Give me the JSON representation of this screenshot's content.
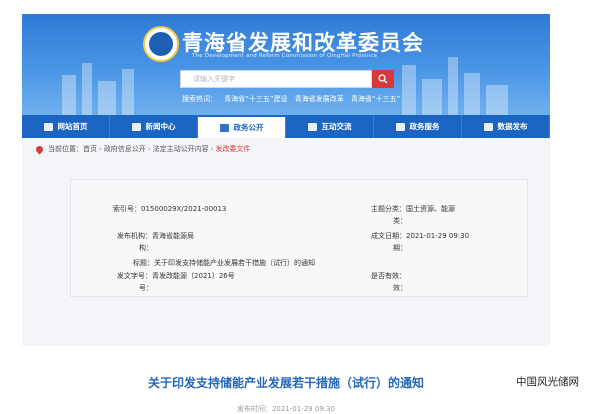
{
  "header": {
    "title": "青海省发展和改革委员会",
    "subtitle": "The Development and Reform Commission of QingHai Province",
    "search_placeholder": "请输入关键字",
    "hot_label": "搜索热词：",
    "hot_terms": [
      "青海省“十三五”建设",
      "青海省发展改革",
      "青海省“十三五”"
    ]
  },
  "nav": {
    "items": [
      {
        "label": "网站首页"
      },
      {
        "label": "新闻中心"
      },
      {
        "label": "政务公开"
      },
      {
        "label": "互动交流"
      },
      {
        "label": "政务服务"
      },
      {
        "label": "数据发布"
      }
    ]
  },
  "breadcrumb": {
    "prefix": "当前位置：",
    "items": [
      "首页",
      "政府信息公开",
      "法定主动公开内容",
      "发改委文件"
    ]
  },
  "info": {
    "index_label": "索引号：",
    "index_value": "01500029X/2021-00013",
    "org_label_1": "发布机构：",
    "org_value": "青海省能源局",
    "org_label_2": "构：",
    "title_label": "标题：",
    "title_value": "关于印发支持储能产业发展若干措施（试行）的通知",
    "doc_label_1": "发文字号：",
    "doc_value": "青发改能源〔2021〕26号",
    "doc_label_2": "号：",
    "category_label_1": "主题分类：",
    "category_value": "国土资源、能源",
    "category_label_2": "类：",
    "date_label_1": "成文日期：",
    "date_value": "2021-01-29 09:30",
    "date_label_2": "期：",
    "valid_label_1": "是否有效：",
    "valid_label_2": "效："
  },
  "article": {
    "title": "关于印发支持储能产业发展若干措施（试行）的通知",
    "date_label": "发布时间：",
    "date_value": "2021-01-29 09:30"
  },
  "watermark": "中国风光储网",
  "colors": {
    "nav_blue": "#1b64c2",
    "accent_red": "#d83a3a",
    "title_blue": "#2566b8"
  }
}
